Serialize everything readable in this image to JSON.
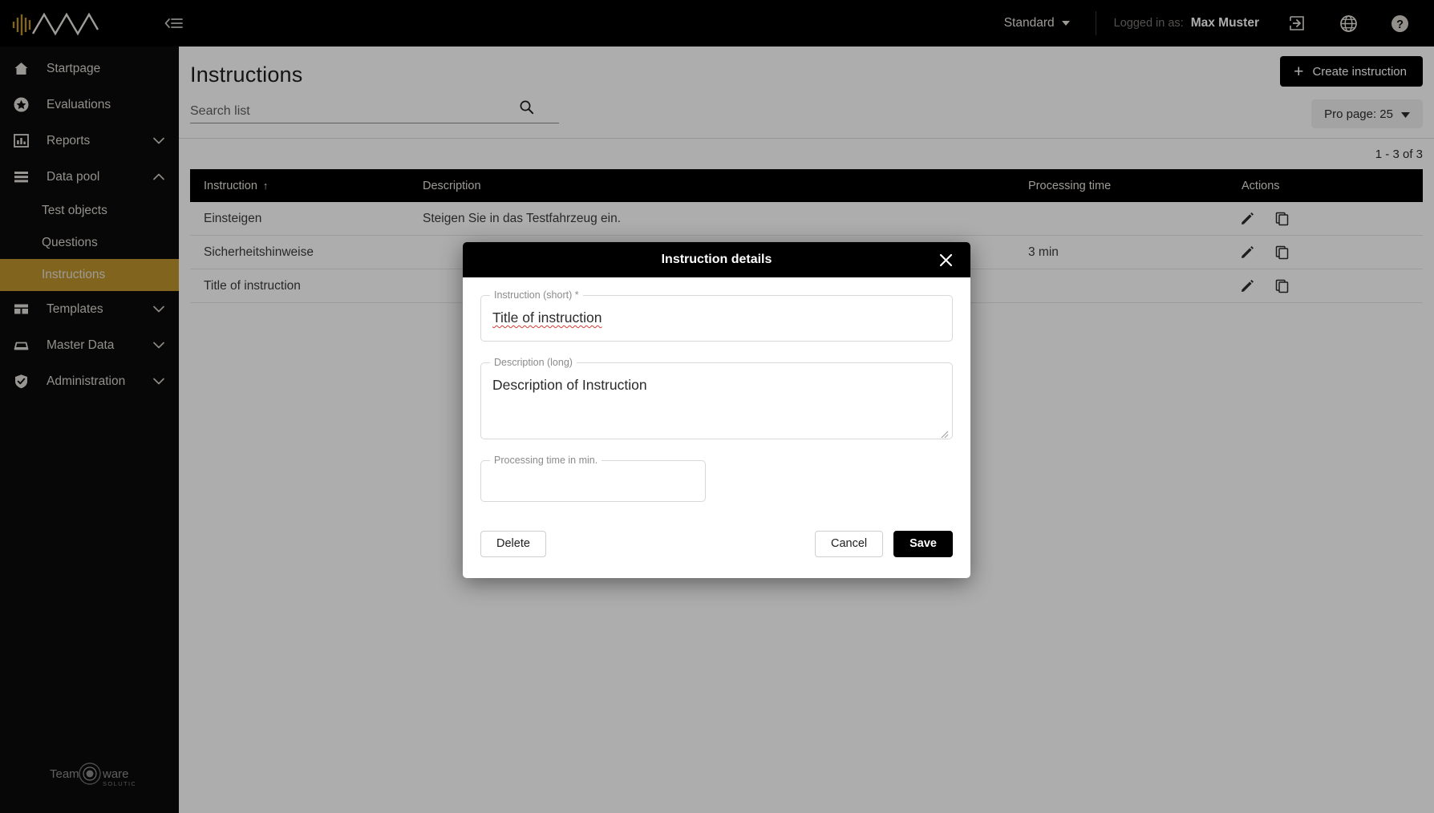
{
  "topbar": {
    "logo_name": "nva-waveform-logo",
    "menu_toggle_icon": "collapse-menu-icon",
    "profile_mode": "Standard",
    "logged_in_label": "Logged in as:",
    "user_name": "Max Muster",
    "logout_icon": "logout-icon",
    "language_icon": "globe-icon",
    "help_icon": "help-icon",
    "accent_gold": "#bf952f",
    "background": "#000000"
  },
  "sidebar": {
    "items": [
      {
        "label": "Startpage",
        "icon": "home-icon",
        "expandable": false
      },
      {
        "label": "Evaluations",
        "icon": "star-icon",
        "expandable": false
      },
      {
        "label": "Reports",
        "icon": "bar-chart-icon",
        "expandable": true,
        "expanded": false
      },
      {
        "label": "Data pool",
        "icon": "list-icon",
        "expandable": true,
        "expanded": true
      },
      {
        "label": "Templates",
        "icon": "layout-icon",
        "expandable": true,
        "expanded": false
      },
      {
        "label": "Master Data",
        "icon": "inbox-icon",
        "expandable": true,
        "expanded": false
      },
      {
        "label": "Administration",
        "icon": "shield-check-icon",
        "expandable": true,
        "expanded": false
      }
    ],
    "sub_items": [
      {
        "label": "Test objects",
        "active": false
      },
      {
        "label": "Questions",
        "active": false
      },
      {
        "label": "Instructions",
        "active": true
      }
    ],
    "footer_logo": {
      "part1": "Team",
      "part2": "ware",
      "tagline": "SOLUTIONS"
    }
  },
  "page": {
    "title": "Instructions",
    "search_placeholder": "Search list",
    "search_value": "",
    "search_icon": "search-icon",
    "create_button": "Create instruction",
    "per_page_button": "Pro page: 25",
    "range_label": "1 - 3 of 3"
  },
  "table": {
    "columns": [
      {
        "key": "instruction",
        "label": "Instruction",
        "sorted": true,
        "sort_dir": "asc"
      },
      {
        "key": "description",
        "label": "Description"
      },
      {
        "key": "processing_time",
        "label": "Processing time"
      },
      {
        "key": "actions",
        "label": "Actions"
      }
    ],
    "sort_arrow": "↑",
    "rows": [
      {
        "instruction": "Einsteigen",
        "description": "Steigen Sie in das Testfahrzeug ein.",
        "processing_time": "",
        "edit_icon": "pencil-icon",
        "copy_icon": "copy-icon"
      },
      {
        "instruction": "Sicherheitshinweise",
        "description": "",
        "processing_time": "3 min",
        "edit_icon": "pencil-icon",
        "copy_icon": "copy-icon"
      },
      {
        "instruction": "Title of instruction",
        "description": "",
        "processing_time": "",
        "edit_icon": "pencil-icon",
        "copy_icon": "copy-icon"
      }
    ]
  },
  "modal": {
    "title": "Instruction details",
    "close_icon": "close-icon",
    "fields": {
      "short": {
        "label": "Instruction (short) *",
        "value": "Title of instruction"
      },
      "long": {
        "label": "Description (long)",
        "value": "Description of Instruction"
      },
      "time": {
        "label": "Processing time in min.",
        "value": ""
      }
    },
    "buttons": {
      "delete": "Delete",
      "cancel": "Cancel",
      "save": "Save"
    }
  }
}
